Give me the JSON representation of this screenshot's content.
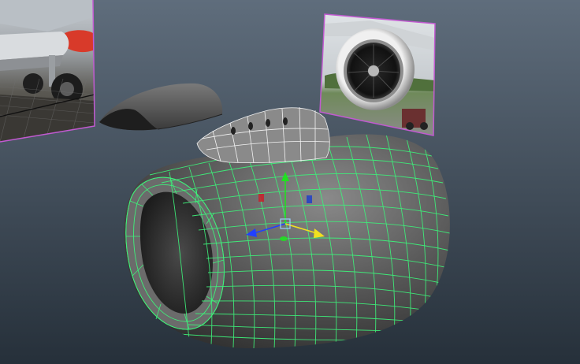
{
  "viewport": {
    "background_top": "#5f6d7c",
    "background_bottom": "#2b3540",
    "wireframe_color": "#3ef07a",
    "image_plane_border": "#c25ad1"
  },
  "scene": {
    "objects": [
      {
        "name": "reference-image-plane-side",
        "type": "image-plane"
      },
      {
        "name": "reference-image-plane-front",
        "type": "image-plane"
      },
      {
        "name": "engine-nacelle-mesh",
        "type": "polygon-mesh",
        "selected": true
      },
      {
        "name": "pylon-fairing-mesh",
        "type": "polygon-mesh"
      },
      {
        "name": "cowling-panel-mesh",
        "type": "polygon-mesh"
      }
    ]
  },
  "manipulator": {
    "type": "move",
    "axes": [
      "x",
      "y",
      "z"
    ],
    "axis_colors": {
      "x": "#ff2020",
      "y": "#20e020",
      "z": "#2040ff",
      "view": "#f0e020"
    }
  }
}
